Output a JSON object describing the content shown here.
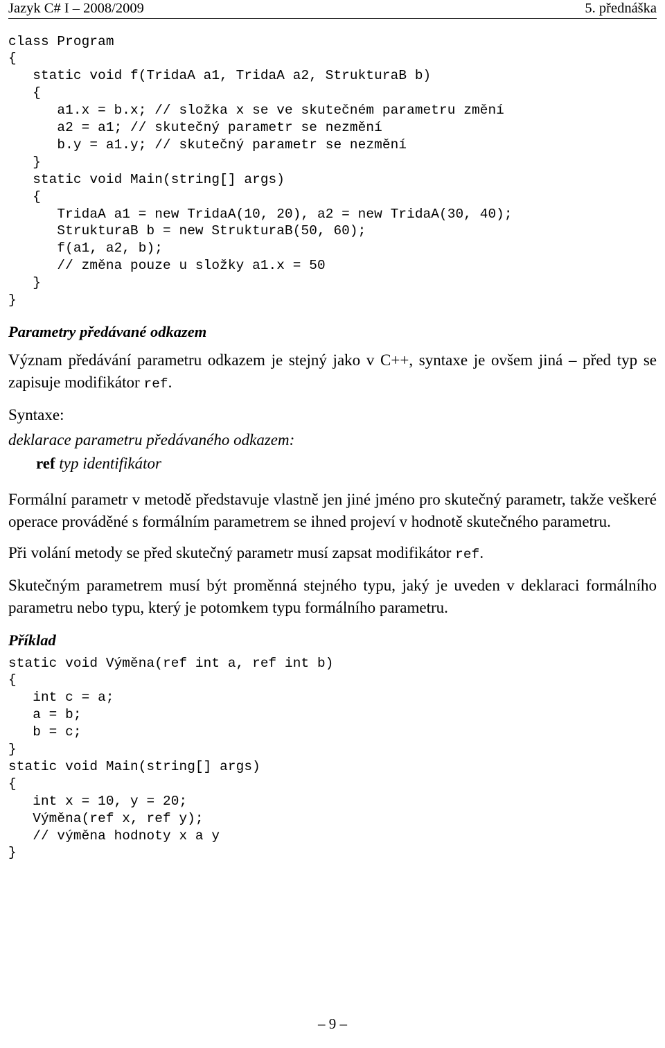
{
  "header": {
    "left": "Jazyk C# I – 2008/2009",
    "right": "5. přednáška"
  },
  "code_block_1": "class Program\n{\n   static void f(TridaA a1, TridaA a2, StrukturaB b)\n   {\n      a1.x = b.x; // složka x se ve skutečném parametru změní\n      a2 = a1; // skutečný parametr se nezmění\n      b.y = a1.y; // skutečný parametr se nezmění\n   }\n   static void Main(string[] args)\n   {\n      TridaA a1 = new TridaA(10, 20), a2 = new TridaA(30, 40);\n      StrukturaB b = new StrukturaB(50, 60);\n      f(a1, a2, b);\n      // změna pouze u složky a1.x = 50\n   }\n}",
  "heading_parametry": "Parametry předávané odkazem",
  "para_vyznam": {
    "before_code": "Význam předávání parametru odkazem je stejný jako v C++, syntaxe je ovšem jiná – před typ se zapisuje modifikátor ",
    "code": "ref",
    "after_code": "."
  },
  "label_syntaxe": "Syntaxe:",
  "syntax_label": "deklarace parametru předávaného odkazem:",
  "syntax_form": {
    "keyword": "ref",
    "rest": " typ identifikátor"
  },
  "para_formalni": "Formální parametr v metodě představuje vlastně jen jiné jméno pro skutečný parametr, takže veškeré operace prováděné s formálním parametrem se ihned projeví v hodnotě skutečného parametru.",
  "para_privolani": {
    "before_code": "Při volání metody se před skutečný parametr musí zapsat modifikátor ",
    "code": "ref",
    "after_code": "."
  },
  "para_skutecnym": "Skutečným parametrem musí být proměnná stejného typu, jaký je uveden v deklaraci formálního parametru nebo typu, který je potomkem typu formálního parametru.",
  "heading_priklad": "Příklad",
  "code_block_2": "static void Výměna(ref int a, ref int b)\n{\n   int c = a;\n   a = b;\n   b = c;\n}\nstatic void Main(string[] args)\n{\n   int x = 10, y = 20;\n   Výměna(ref x, ref y);\n   // výměna hodnoty x a y\n}",
  "footer": {
    "page_marker": "– 9 –"
  }
}
